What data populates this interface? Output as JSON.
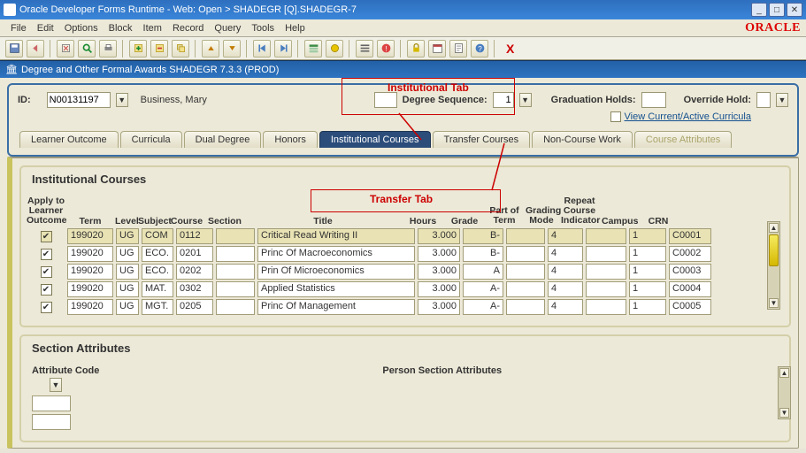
{
  "window": {
    "title": "Oracle Developer Forms Runtime - Web:  Open > SHADEGR [Q].SHADEGR-7"
  },
  "menu": {
    "items": [
      "File",
      "Edit",
      "Options",
      "Block",
      "Item",
      "Record",
      "Query",
      "Tools",
      "Help"
    ],
    "brand": "ORACLE"
  },
  "form_bar": {
    "title": "Degree and Other Formal Awards  SHADEGR  7.3.3  (PROD)"
  },
  "keyblock": {
    "id_label": "ID:",
    "id_value": "N00131197",
    "name": "Business, Mary",
    "degree_seq_label": "Degree Sequence:",
    "degree_seq_value": "1",
    "grad_holds_label": "Graduation Holds:",
    "grad_holds_value": "",
    "override_hold_label": "Override Hold:",
    "view_current_label": "View Current/Active Curricula"
  },
  "tabs": {
    "learner": "Learner Outcome",
    "curricula": "Curricula",
    "dual": "Dual Degree",
    "honors": "Honors",
    "inst": "Institutional Courses",
    "transfer": "Transfer Courses",
    "noncourse": "Non-Course Work",
    "attrs": "Course Attributes"
  },
  "inst_section": {
    "heading": "Institutional Courses",
    "headers": {
      "apply": "Apply to Learner Outcome",
      "term": "Term",
      "level": "Level",
      "subject": "Subject",
      "course": "Course",
      "section": "Section",
      "title": "Title",
      "hours": "Hours",
      "grade": "Grade",
      "partterm": "Part of Term",
      "gmode": "Grading Mode",
      "repeat": "Repeat Course Indicator",
      "campus": "Campus",
      "crn": "CRN"
    },
    "rows": [
      {
        "apply": true,
        "term": "199020",
        "level": "UG",
        "subject": "COM",
        "course": "0112",
        "section": "",
        "title": "Critical Read Writing II",
        "hours": "3.000",
        "grade": "B-",
        "partterm": "",
        "gmode": "4",
        "repeat": "",
        "campus": "1",
        "crn": "C0001"
      },
      {
        "apply": true,
        "term": "199020",
        "level": "UG",
        "subject": "ECO.",
        "course": "0201",
        "section": "",
        "title": "Princ Of Macroeconomics",
        "hours": "3.000",
        "grade": "B-",
        "partterm": "",
        "gmode": "4",
        "repeat": "",
        "campus": "1",
        "crn": "C0002"
      },
      {
        "apply": true,
        "term": "199020",
        "level": "UG",
        "subject": "ECO.",
        "course": "0202",
        "section": "",
        "title": "Prin Of Microeconomics",
        "hours": "3.000",
        "grade": "A",
        "partterm": "",
        "gmode": "4",
        "repeat": "",
        "campus": "1",
        "crn": "C0003"
      },
      {
        "apply": true,
        "term": "199020",
        "level": "UG",
        "subject": "MAT.",
        "course": "0302",
        "section": "",
        "title": "Applied Statistics",
        "hours": "3.000",
        "grade": "A-",
        "partterm": "",
        "gmode": "4",
        "repeat": "",
        "campus": "1",
        "crn": "C0004"
      },
      {
        "apply": true,
        "term": "199020",
        "level": "UG",
        "subject": "MGT.",
        "course": "0205",
        "section": "",
        "title": "Princ Of Management",
        "hours": "3.000",
        "grade": "A-",
        "partterm": "",
        "gmode": "4",
        "repeat": "",
        "campus": "1",
        "crn": "C0005"
      }
    ]
  },
  "sec_attr": {
    "heading": "Section Attributes",
    "attr_code_label": "Attribute Code",
    "person_label": "Person Section Attributes"
  },
  "callouts": {
    "inst_tab": "Institutional Tab",
    "transfer_tab": "Transfer Tab"
  }
}
